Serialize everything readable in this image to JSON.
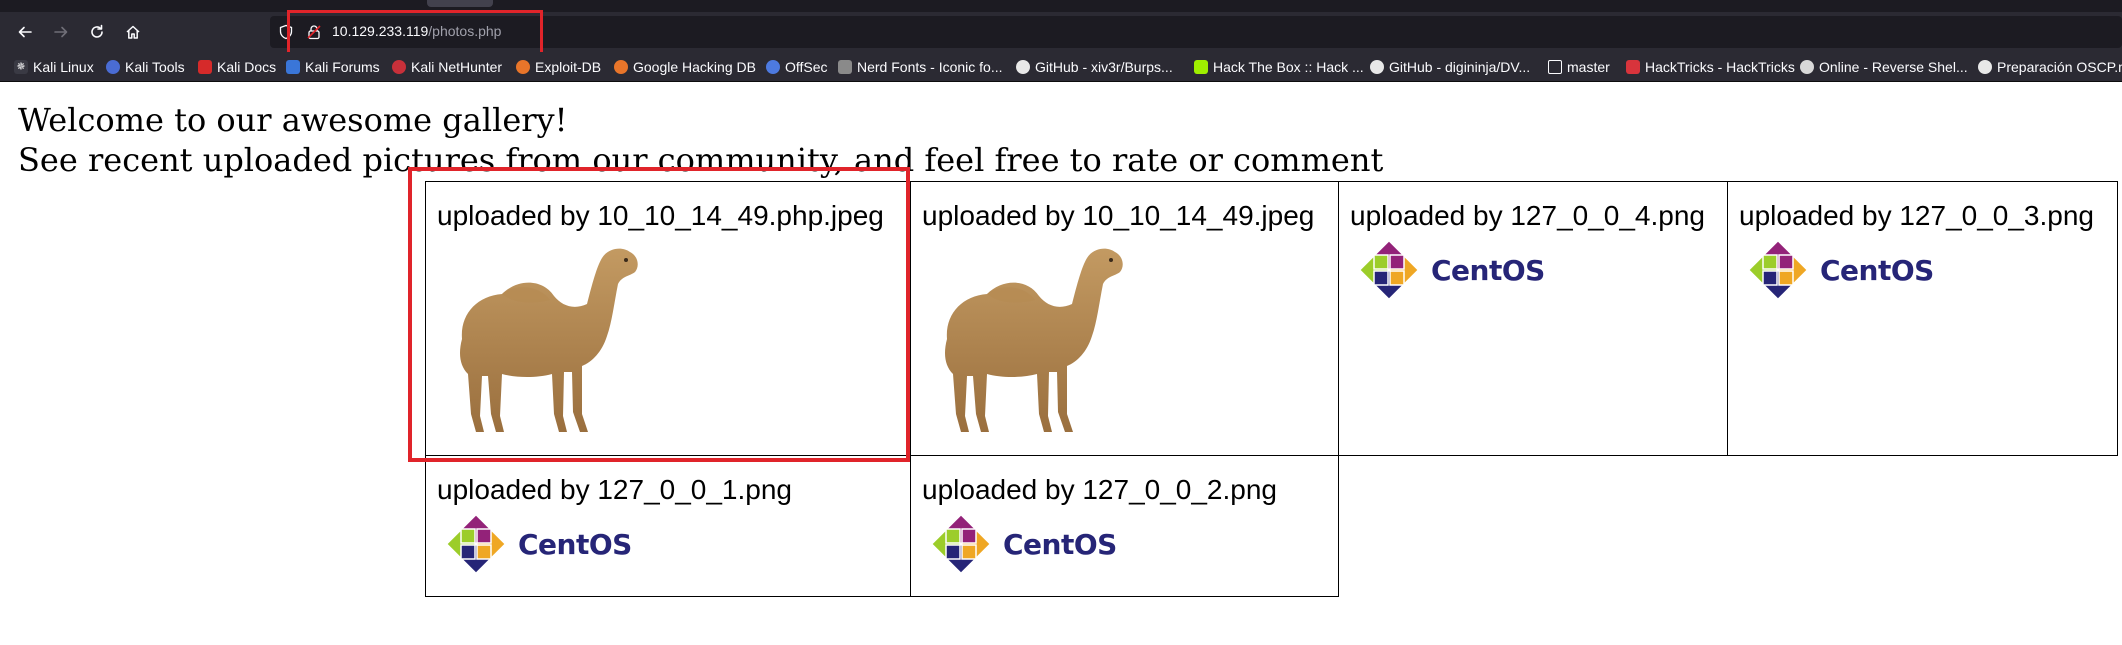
{
  "browser": {
    "url_host": "10.129.233.119",
    "url_path": "/photos.php",
    "nav": {
      "back_icon": "arrow-left-icon",
      "forward_icon": "arrow-right-icon",
      "reload_icon": "reload-icon",
      "home_icon": "home-icon"
    },
    "colors": {
      "chrome": "#2b2a33",
      "urlbar": "#1c1b22",
      "highlight": "#e0242a"
    },
    "bookmarks": [
      {
        "label": "Kali Linux",
        "icon": "kali-dragon-icon"
      },
      {
        "label": "Kali Tools",
        "icon": "kali-tools-icon"
      },
      {
        "label": "Kali Docs",
        "icon": "kali-docs-icon"
      },
      {
        "label": "Kali Forums",
        "icon": "kali-forums-icon"
      },
      {
        "label": "Kali NetHunter",
        "icon": "nethunter-icon"
      },
      {
        "label": "Exploit-DB",
        "icon": "exploit-db-icon"
      },
      {
        "label": "Google Hacking DB",
        "icon": "ghdb-icon"
      },
      {
        "label": "OffSec",
        "icon": "offsec-icon"
      },
      {
        "label": "Nerd Fonts - Iconic fo...",
        "icon": "nerd-fonts-icon"
      },
      {
        "label": "GitHub - xiv3r/Burps...",
        "icon": "github-icon"
      },
      {
        "label": "Hack The Box :: Hack ...",
        "icon": "htb-icon"
      },
      {
        "label": "GitHub - digininja/DV...",
        "icon": "github-icon"
      },
      {
        "label": "master",
        "icon": "folder-icon"
      },
      {
        "label": "HackTricks - HackTricks",
        "icon": "hacktricks-icon"
      },
      {
        "label": "Online - Reverse Shel...",
        "icon": "skull-icon"
      },
      {
        "label": "Preparación OSCP.m",
        "icon": "github-icon"
      }
    ]
  },
  "page": {
    "welcome": "Welcome to our awesome gallery!",
    "subline": "See recent uploaded pictures from our community, and feel free to rate or comment",
    "gallery": [
      {
        "caption": "uploaded by 10_10_14_49.php.jpeg",
        "image": "camel"
      },
      {
        "caption": "uploaded by 10_10_14_49.jpeg",
        "image": "camel"
      },
      {
        "caption": "uploaded by 127_0_0_4.png",
        "image": "centos"
      },
      {
        "caption": "uploaded by 127_0_0_3.png",
        "image": "centos"
      },
      {
        "caption": "uploaded by 127_0_0_1.png",
        "image": "centos"
      },
      {
        "caption": "uploaded by 127_0_0_2.png",
        "image": "centos"
      }
    ],
    "centos_wordmark": "CentOS"
  }
}
